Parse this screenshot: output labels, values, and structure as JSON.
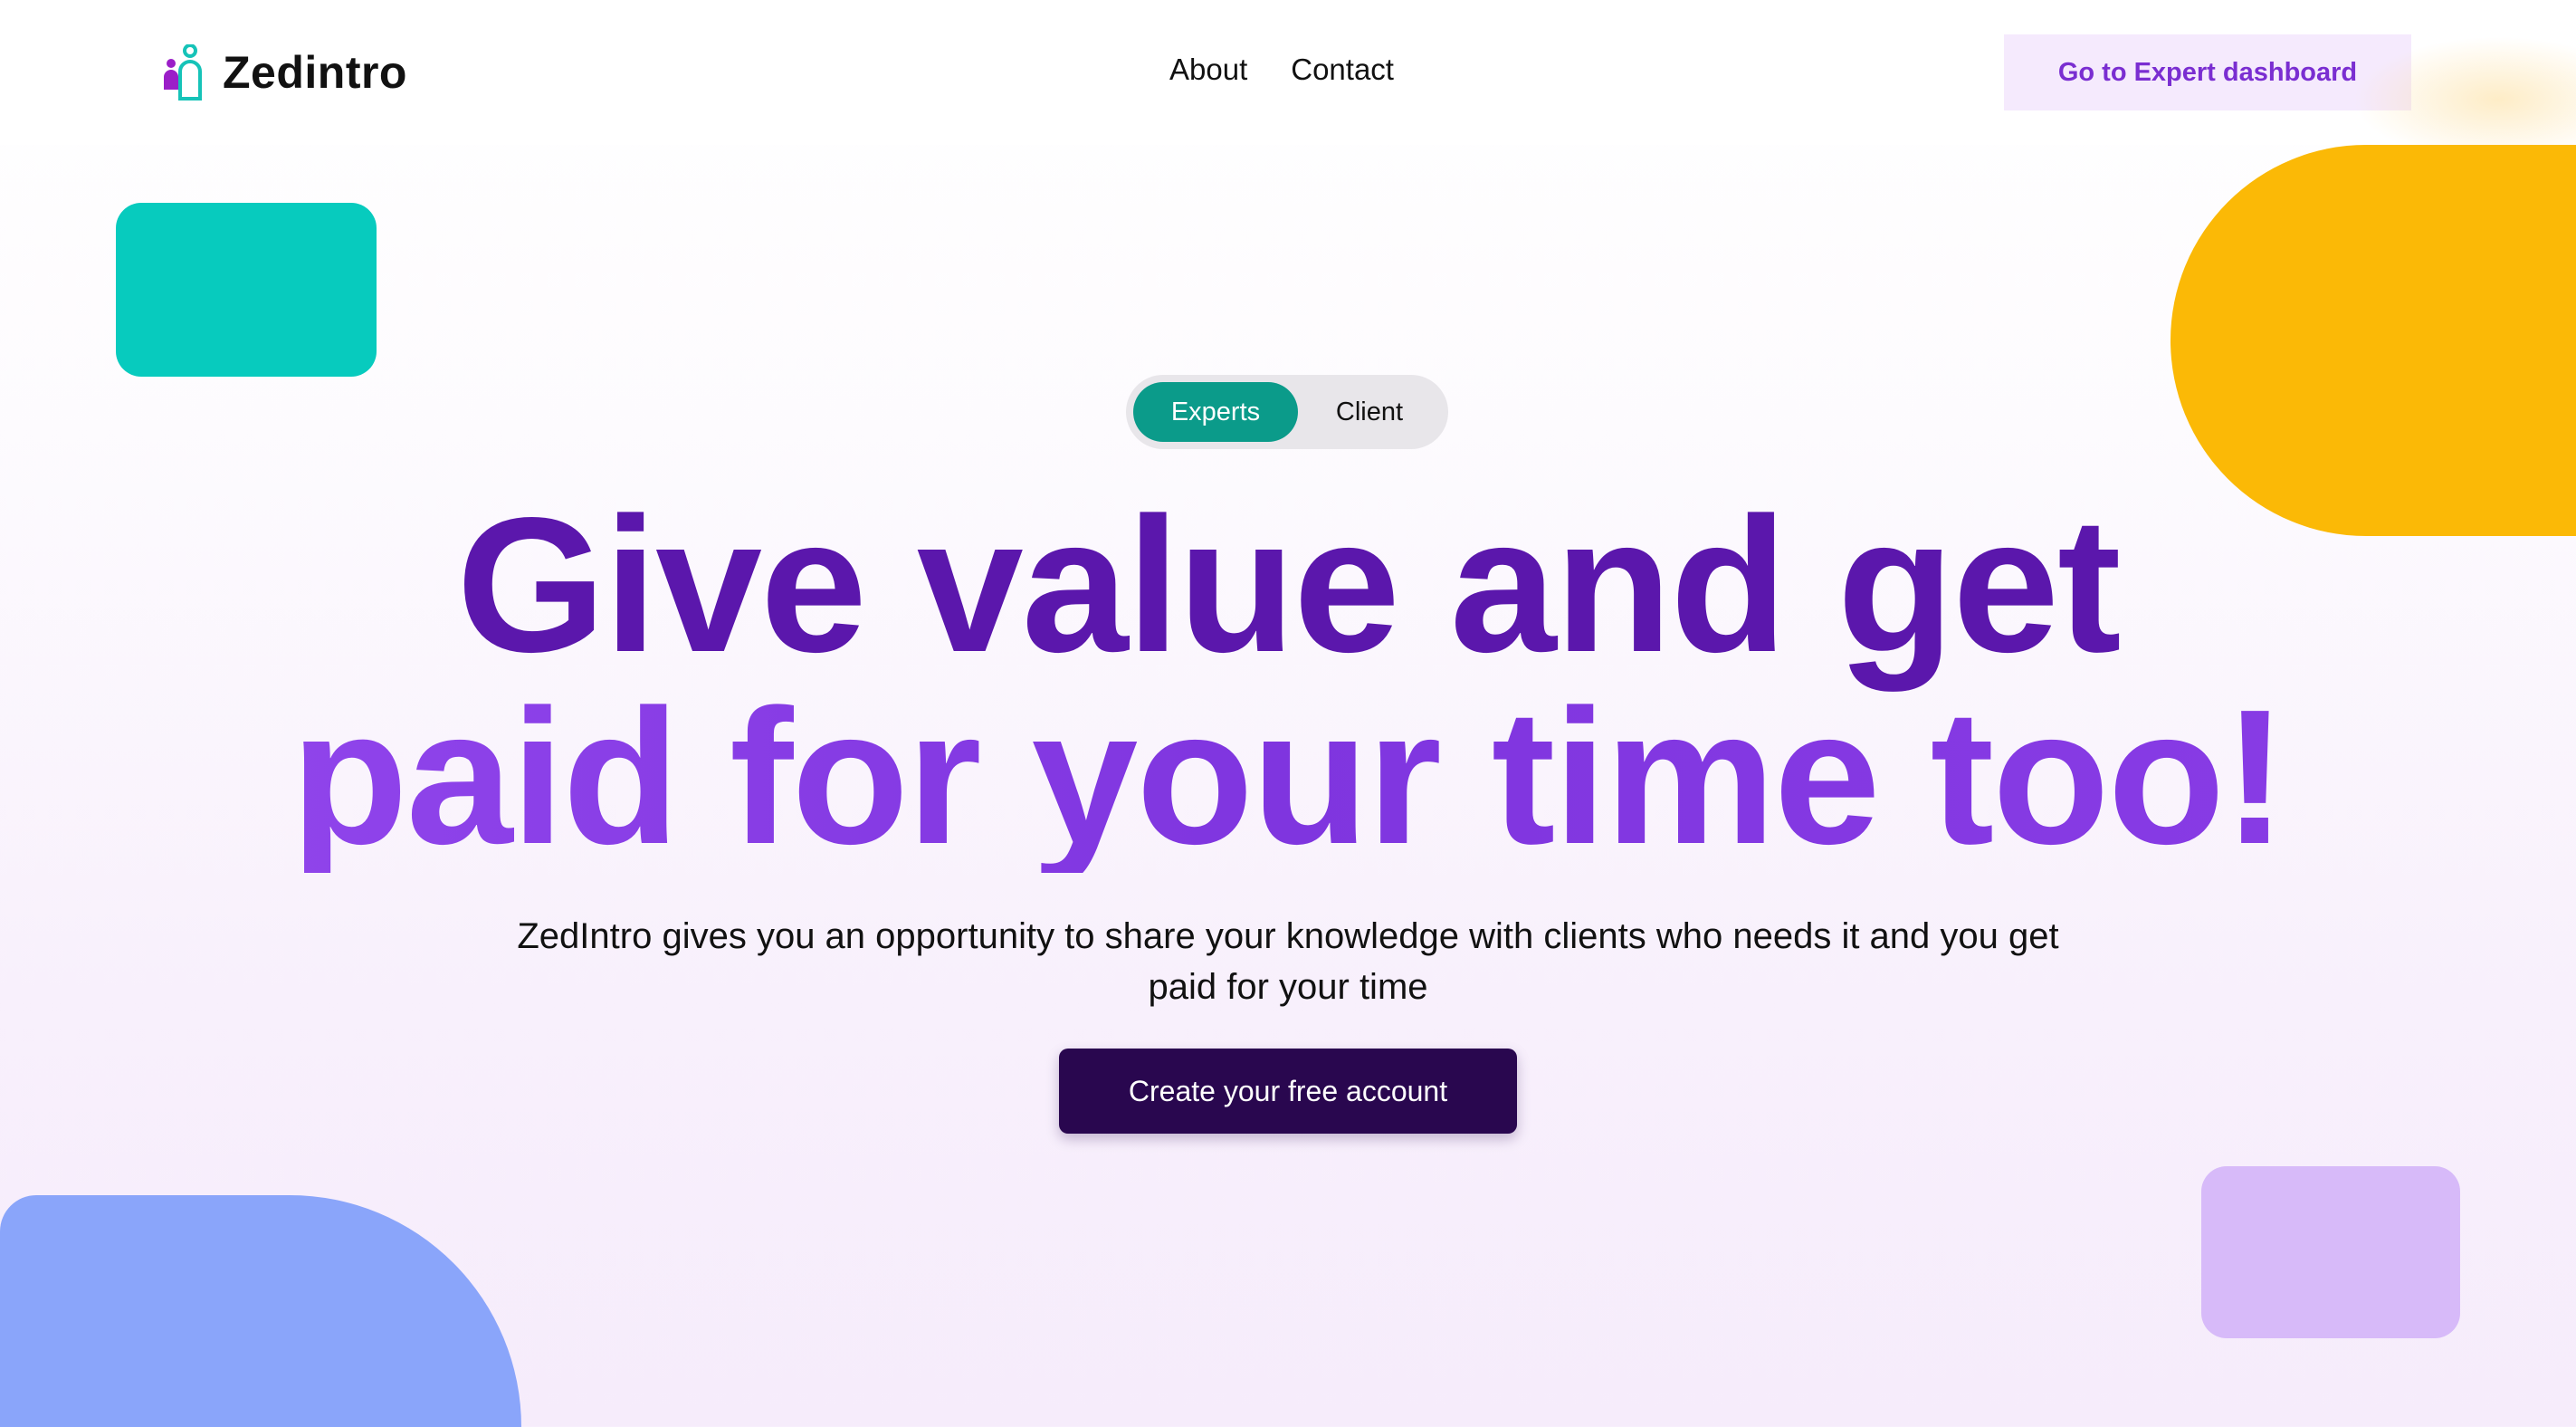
{
  "brand": {
    "name": "Zedintro",
    "accent_magenta": "#9b1ec8",
    "accent_teal": "#16c3b8"
  },
  "nav": {
    "items": [
      {
        "label": "About"
      },
      {
        "label": "Contact"
      }
    ]
  },
  "header": {
    "dashboard_button_label": "Go to Expert dashboard"
  },
  "hero": {
    "toggle": {
      "options": [
        {
          "label": "Experts",
          "active": true
        },
        {
          "label": "Client",
          "active": false
        }
      ]
    },
    "headline_line1": "Give value and get",
    "headline_line2": "paid for your time too!",
    "subtext": "ZedIntro gives you an opportunity to share your knowledge with clients who needs it and you get paid for your time",
    "cta_label": "Create your free account"
  },
  "colors": {
    "headline_dark": "#5b17ac",
    "headline_light": "#8f3ee6",
    "cta_bg": "#29074f",
    "toggle_active": "#0b9b8a",
    "shape_teal": "#07cbbe",
    "shape_yellow": "#fbb906",
    "shape_blue": "#8aa5fa",
    "shape_lilac": "#d7baf9"
  }
}
